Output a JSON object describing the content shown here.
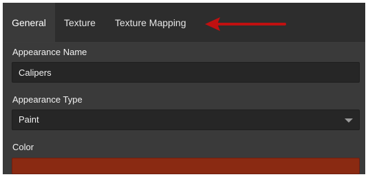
{
  "tabs": {
    "general": "General",
    "texture": "Texture",
    "texture_mapping": "Texture Mapping"
  },
  "annotation": {
    "arrow_color": "#c01010"
  },
  "appearance_name": {
    "label": "Appearance Name",
    "value": "Calipers"
  },
  "appearance_type": {
    "label": "Appearance Type",
    "value": "Paint"
  },
  "color": {
    "label": "Color",
    "value": "#8a2a12"
  }
}
